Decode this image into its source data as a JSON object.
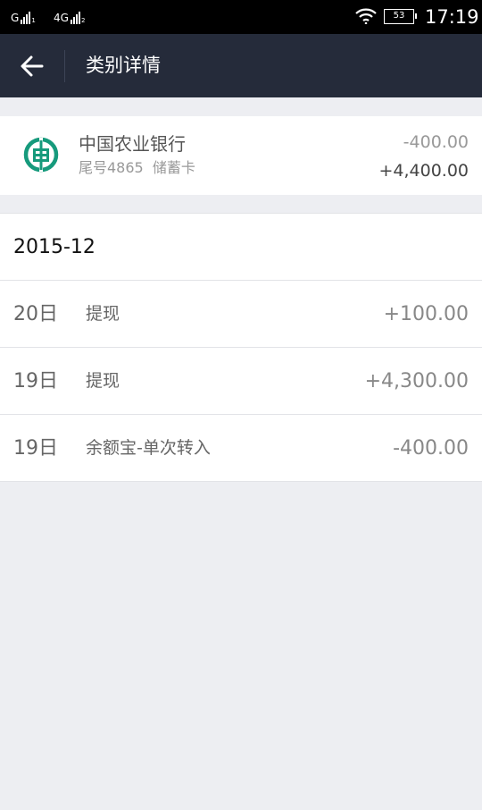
{
  "status_bar": {
    "signal1_label": "G",
    "signal1_sub": "1",
    "signal2_label": "4G",
    "signal2_sub": "2",
    "battery": "53",
    "time": "17:19",
    "icons": [
      "signal-icon",
      "wifi-icon",
      "battery-icon"
    ]
  },
  "nav": {
    "back_icon": "arrow-left-icon",
    "title": "类别详情",
    "bg_color": "#252b3a"
  },
  "account": {
    "bank_name": "中国农业银行",
    "card_info": "尾号4865  储蓄卡",
    "amount_out": "-400.00",
    "amount_in": "+4,400.00",
    "logo_icon": "abc-bank-logo-icon",
    "logo_color": "#169a7c"
  },
  "transactions": {
    "month": "2015-12",
    "rows": [
      {
        "day": "20日",
        "desc": "提现",
        "amount": "+100.00"
      },
      {
        "day": "19日",
        "desc": "提现",
        "amount": "+4,300.00"
      },
      {
        "day": "19日",
        "desc": "余额宝-单次转入",
        "amount": "-400.00"
      }
    ]
  }
}
